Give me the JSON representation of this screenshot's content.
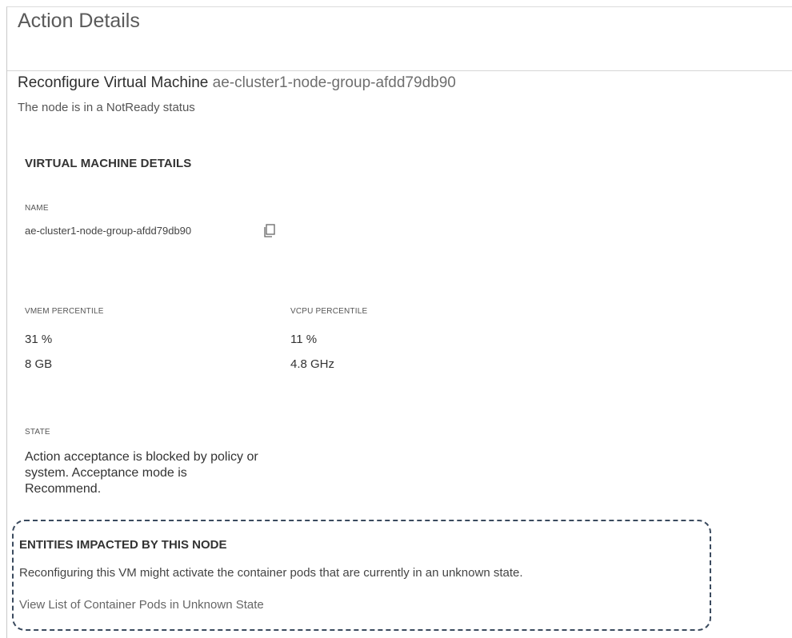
{
  "header": {
    "title": "Action Details"
  },
  "action": {
    "type": "Reconfigure Virtual Machine",
    "entity": "ae-cluster1-node-group-afdd79db90",
    "reason": "The node is in a NotReady status"
  },
  "details": {
    "section_title": "VIRTUAL MACHINE DETAILS",
    "name_label": "NAME",
    "name_value": "ae-cluster1-node-group-afdd79db90",
    "copy_icon": "copy-icon",
    "vmem": {
      "label": "VMEM PERCENTILE",
      "percent": "31 %",
      "amount": "8 GB"
    },
    "vcpu": {
      "label": "VCPU PERCENTILE",
      "percent": "11 %",
      "amount": "4.8 GHz"
    },
    "state_label": "STATE",
    "state_value": "Action acceptance is blocked by policy or system. Acceptance mode is Recommend."
  },
  "impact": {
    "title": "ENTITIES IMPACTED BY THIS NODE",
    "text": "Reconfiguring this VM might activate the container pods that are currently in an unknown state.",
    "link": "View List of Container Pods in Unknown State"
  }
}
